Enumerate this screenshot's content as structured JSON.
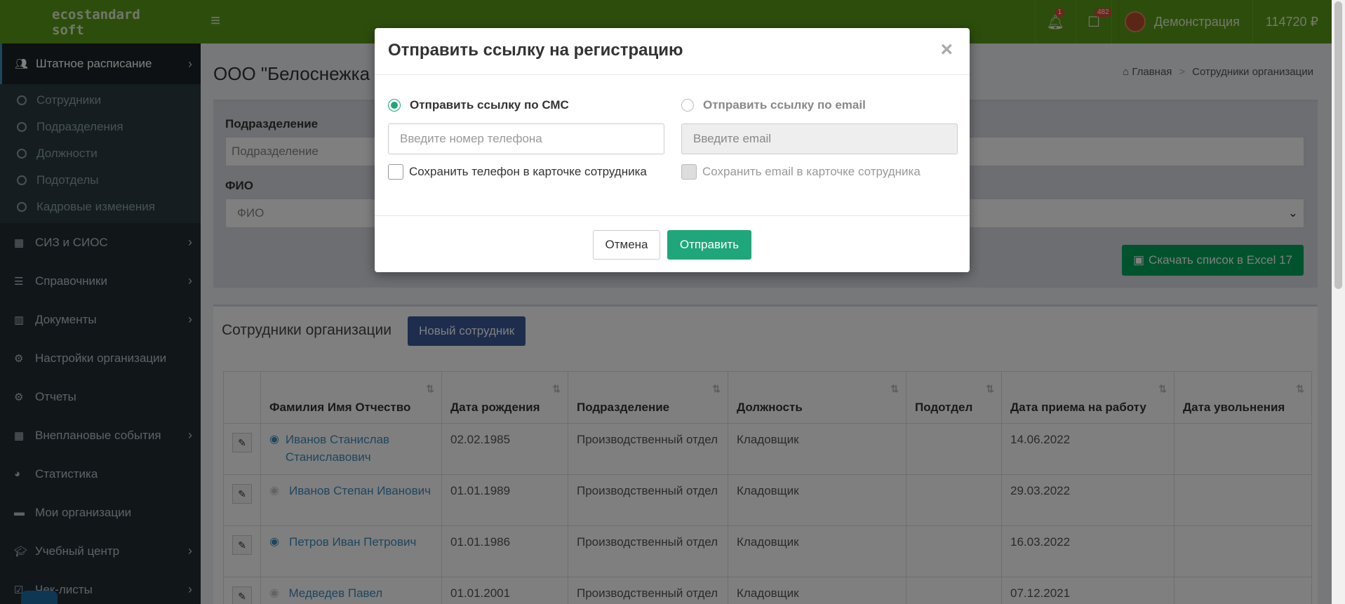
{
  "header": {
    "logo_line1": "ecostandard",
    "logo_line2": "soft",
    "notifications_badge": "1",
    "tasks_badge": "482",
    "user_name": "Демонстрация",
    "balance": "114720 ₽"
  },
  "sidebar": {
    "active": {
      "label": "Штатное расписание",
      "icon": "users-icon"
    },
    "subitems": [
      "Сотрудники",
      "Подразделения",
      "Должности",
      "Подотделы",
      "Кадровые изменения"
    ],
    "items": [
      {
        "label": "СИЗ и СИОС",
        "icon": "calendar-check-icon",
        "chevron": true
      },
      {
        "label": "Справочники",
        "icon": "list-icon",
        "chevron": true
      },
      {
        "label": "Документы",
        "icon": "barcode-icon",
        "chevron": true
      },
      {
        "label": "Настройки организации",
        "icon": "gear-icon",
        "chevron": false
      },
      {
        "label": "Отчеты",
        "icon": "gear-icon",
        "chevron": false
      },
      {
        "label": "Внеплановые события",
        "icon": "calendar-icon",
        "chevron": true
      },
      {
        "label": "Статистика",
        "icon": "pie-chart-icon",
        "chevron": false
      },
      {
        "label": "Мои организации",
        "icon": "briefcase-icon",
        "chevron": false
      },
      {
        "label": "Учебный центр",
        "icon": "graduation-cap-icon",
        "chevron": true
      },
      {
        "label": "Чек-листы",
        "icon": "checkbox-icon",
        "chevron": true
      }
    ]
  },
  "page": {
    "title": "ООО \"Белоснежка",
    "breadcrumb_home": "Главная",
    "breadcrumb_current": "Сотрудники организации"
  },
  "filters": {
    "division_label": "Подразделение",
    "division_placeholder": "Подразделение",
    "fio_label": "ФИО",
    "fio_value": "ФИО",
    "excel_button": "Скачать список в Excel 17"
  },
  "list": {
    "title": "Сотрудники организации",
    "new_button": "Новый сотрудник",
    "columns": [
      "",
      "Фамилия Имя Отчество",
      "Дата рождения",
      "Подразделение",
      "Должность",
      "Подотдел",
      "Дата приема на работу",
      "Дата увольнения"
    ],
    "rows": [
      {
        "name": "Иванов Станислав Станиславович",
        "registered": true,
        "birth": "02.02.1985",
        "division": "Производственный отдел",
        "position": "Кладовщик",
        "subdiv": "",
        "hired": "14.06.2022",
        "fired": ""
      },
      {
        "name": "Иванов Степан Иванович",
        "registered": false,
        "birth": "01.01.1989",
        "division": "Производственный отдел",
        "position": "Кладовщик",
        "subdiv": "",
        "hired": "29.03.2022",
        "fired": ""
      },
      {
        "name": "Петров Иван Петрович",
        "registered": true,
        "birth": "01.01.1986",
        "division": "Производственный отдел",
        "position": "Кладовщик",
        "subdiv": "",
        "hired": "16.03.2022",
        "fired": ""
      },
      {
        "name": "Медведев Павел Юрьевич",
        "registered": false,
        "birth": "01.01.2001",
        "division": "Производственный отдел",
        "position": "Кладовщик",
        "subdiv": "",
        "hired": "07.12.2021",
        "fired": ""
      }
    ]
  },
  "modal": {
    "title": "Отправить ссылку на регистрацию",
    "close": "×",
    "sms_option": "Отправить ссылку по СМС",
    "email_option": "Отправить ссылку по email",
    "phone_placeholder": "Введите номер телефона",
    "email_placeholder": "Введите email",
    "save_phone": "Сохранить телефон в карточке сотрудника",
    "save_email": "Сохранить email в карточке сотрудника",
    "cancel": "Отмена",
    "send": "Отправить"
  },
  "colors": {
    "header_green": "#5b9b18",
    "sidebar_dark": "#222d32",
    "accent_blue": "#3c8dbc",
    "success_green": "#1fa67a"
  }
}
